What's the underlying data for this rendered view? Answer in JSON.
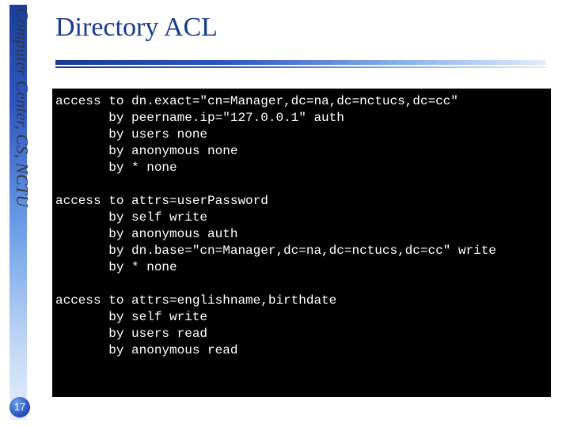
{
  "sidebar": {
    "org_text": "Computer Center, CS, NCTU"
  },
  "title": "Directory ACL",
  "code": {
    "lines": [
      "access to dn.exact=\"cn=Manager,dc=na,dc=nctucs,dc=cc\"",
      "       by peername.ip=\"127.0.0.1\" auth",
      "       by users none",
      "       by anonymous none",
      "       by * none",
      "",
      "access to attrs=userPassword",
      "       by self write",
      "       by anonymous auth",
      "       by dn.base=\"cn=Manager,dc=na,dc=nctucs,dc=cc\" write",
      "       by * none",
      "",
      "access to attrs=englishname,birthdate",
      "       by self write",
      "       by users read",
      "       by anonymous read"
    ]
  },
  "page_number": "17"
}
